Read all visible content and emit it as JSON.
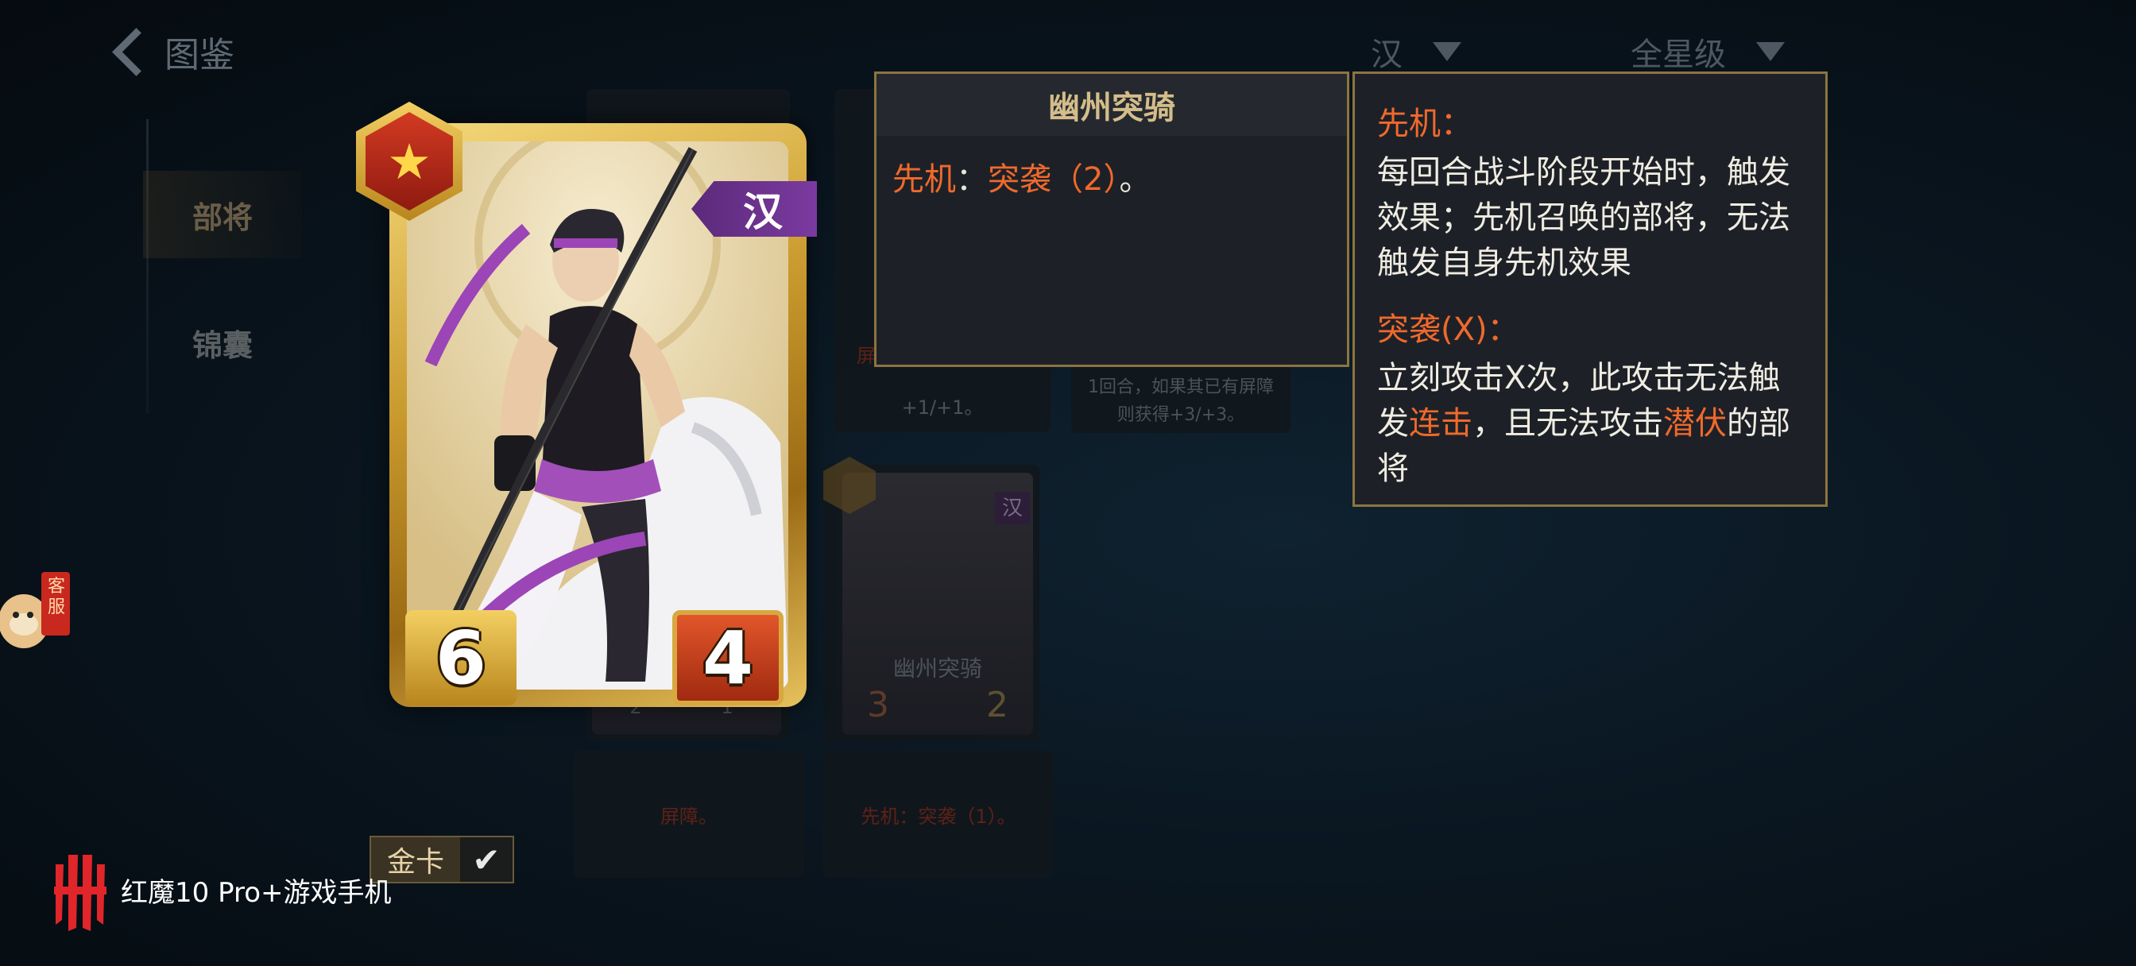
{
  "header": {
    "back_label": "图鉴",
    "faction_filter": "汉",
    "star_filter": "全星级"
  },
  "sidebar": {
    "items": [
      {
        "label": "部将"
      },
      {
        "label": "锦囊"
      }
    ]
  },
  "background_cards": {
    "card1_text_line1": "屏障，自身永久获得",
    "card1_text_line2": "+1/+1。",
    "card2_text_line1": "1回合，如果其已有屏障",
    "card2_text_line2": "则获得+3/+3。",
    "card3_name": "幽州突骑",
    "card3_faction": "汉",
    "card3_atk": "3",
    "card3_hp": "2",
    "card4_atk": "2",
    "card4_hp": "1",
    "card4_text": "屏障。",
    "card3_text": "先机：突袭（1）。"
  },
  "selected_card": {
    "name": "幽州突骑",
    "faction": "汉",
    "star": "★",
    "attack": "6",
    "health": "4",
    "skill_keyword": "先机",
    "skill_sep": "：",
    "skill_effect": "突袭（2）",
    "skill_end": "。"
  },
  "keywords": [
    {
      "title": "先机：",
      "text": "每回合战斗阶段开始时，触发效果；先机召唤的部将，无法触发自身先机效果"
    },
    {
      "title": "突袭(X)：",
      "text_part1": "立刻攻击X次，此攻击无法触发",
      "hl1": "连击",
      "text_part2": "，且无法攻击",
      "hl2": "潜伏",
      "text_part3": "的部将"
    }
  ],
  "gold_card": {
    "label": "金卡",
    "check": "✔"
  },
  "brand": {
    "text": "红魔10 Pro+游戏手机"
  },
  "service_label": "客服",
  "colors": {
    "accent_orange": "#f0692c",
    "frame_gold": "#c99a2d",
    "faction_purple": "#6b3290"
  }
}
